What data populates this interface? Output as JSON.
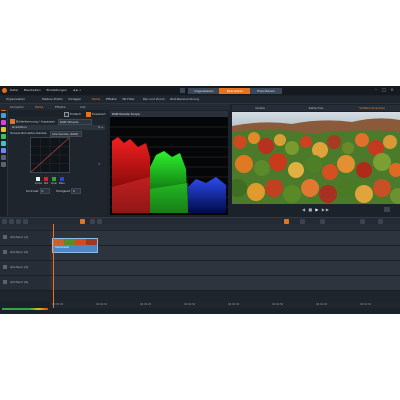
{
  "window": {
    "app_menu": [
      "Datei",
      "Bearbeiten",
      "Einstellungen"
    ],
    "modes": [
      {
        "label": "Organisieren",
        "active": false
      },
      {
        "label": "Bearbeiten",
        "active": true
      },
      {
        "label": "Exportieren",
        "active": false
      }
    ],
    "accent": "#e8731d"
  },
  "toolbar2": {
    "items": [
      "Organisation",
      "Medien-Editor",
      "Vorlagen",
      "Farbe",
      "Effekte",
      "3D-Titler",
      "Pan und Zoom",
      "Zeit-Neuzuordnung"
    ],
    "active_index": 3
  },
  "panel_tabs": [
    "Korrektur",
    "Farbe",
    "Effekte",
    "Info"
  ],
  "options": {
    "left": "Einfach",
    "right": "Erweitert",
    "scope_label": "RGB Parade Scope",
    "checkbox1": "Video-Ausschnitt",
    "checkbox2": "Teilbild"
  },
  "leftpanel": {
    "row1_label": "Bilderkennung / Anpassen",
    "row1_value": "RGB Wheels",
    "section": "Gradation",
    "row2_label": "Tonwertkorrektur-Kanäle",
    "row2_value": "Alle Kanäle (RGB)",
    "channels": [
      "Luma",
      "Rot",
      "Grün",
      "Blau"
    ],
    "contrast_label": "Kontrast",
    "contrast_value": "0",
    "balance_label": "Helligkeit",
    "balance_value": "0"
  },
  "preview_tabs": [
    {
      "label": "Quelle",
      "active": false
    },
    {
      "label": "Zeitachse",
      "active": false
    },
    {
      "label": "Vollbild-Vorschau",
      "active": true
    }
  ],
  "timeline": {
    "tracks": [
      {
        "name": "A/V-Spur (1)"
      },
      {
        "name": "A/V-Spur (2)"
      },
      {
        "name": "A/V-Spur (3)"
      },
      {
        "name": "A/V-Spur (4)"
      }
    ],
    "clip_label": "Herbstwald",
    "ruler_labels": [
      "00:00:00",
      "00:00:10",
      "00:00:20",
      "00:00:30",
      "00:00:40",
      "00:00:50",
      "00:01:00",
      "00:01:10"
    ]
  },
  "icons": {
    "play": "play-icon",
    "stop": "stop-icon",
    "prev": "previous-frame-icon",
    "next": "next-frame-icon",
    "minimize": "minimize-icon",
    "maximize": "maximize-icon",
    "close": "close-icon"
  }
}
